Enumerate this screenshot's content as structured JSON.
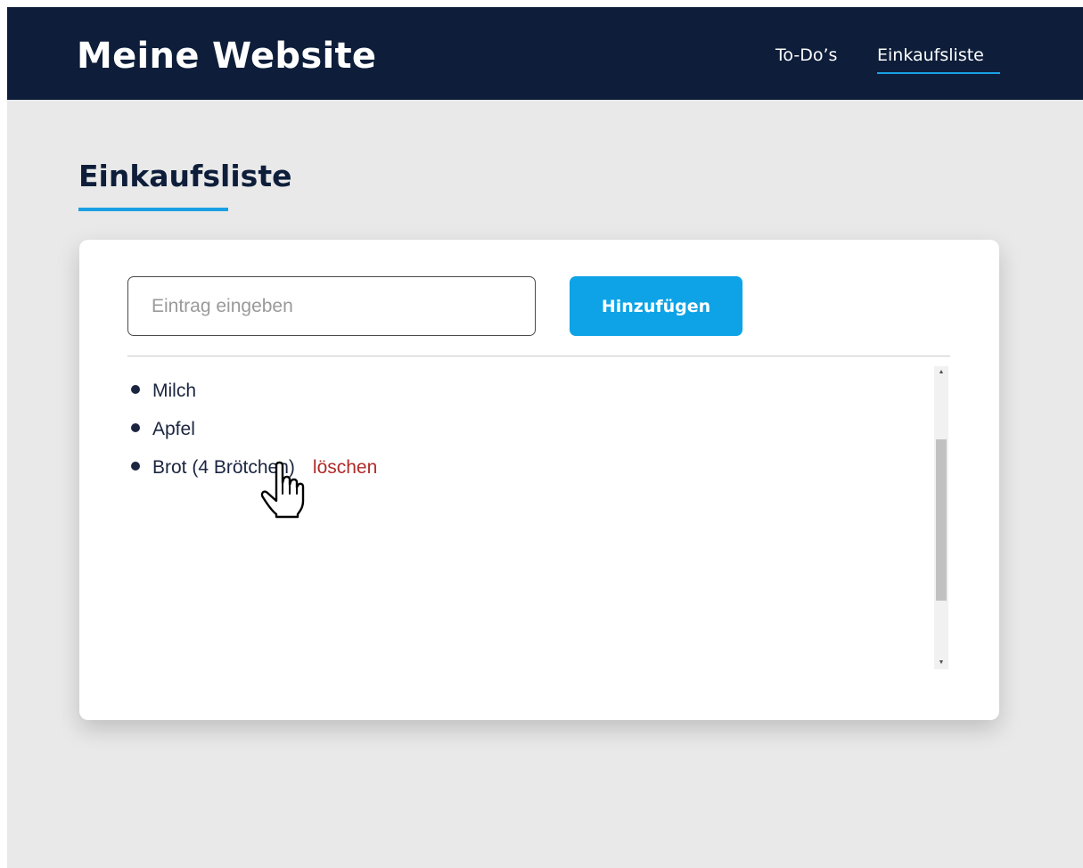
{
  "header": {
    "site_title": "Meine Website",
    "nav": [
      {
        "label": "To-Do’s",
        "active": false
      },
      {
        "label": "Einkaufsliste",
        "active": true
      }
    ]
  },
  "main": {
    "page_title": "Einkaufsliste",
    "input": {
      "value": "",
      "placeholder": "Eintrag eingeben"
    },
    "add_button_label": "Hinzufügen",
    "items": [
      {
        "label": "Milch"
      },
      {
        "label": "Apfel"
      },
      {
        "label": "Brot (4 Brötchen)",
        "delete_label": "löschen"
      }
    ]
  },
  "colors": {
    "header_bg": "#0e1e3a",
    "accent": "#0ea3e6",
    "delete": "#b02a2a",
    "page_bg": "#e9e9e9"
  },
  "icons": {
    "cursor": "hand-pointer-icon",
    "bullet": "bullet-icon"
  }
}
